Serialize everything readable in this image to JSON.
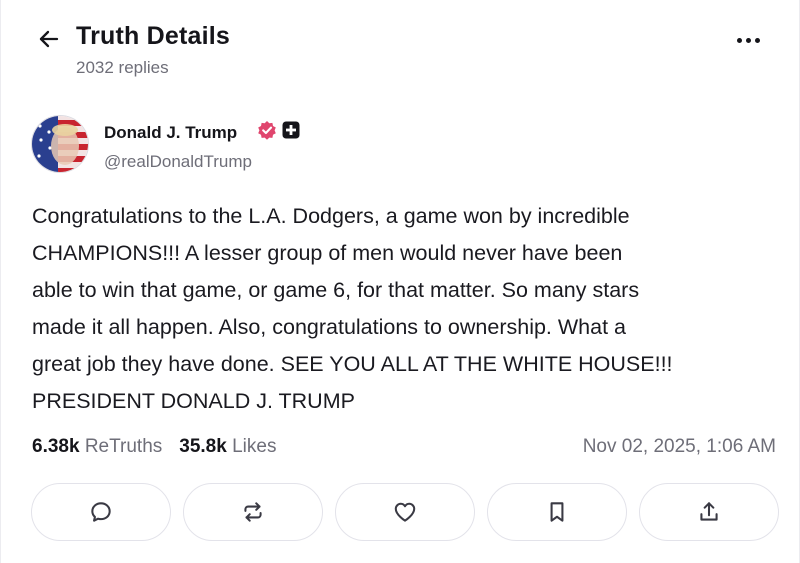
{
  "header": {
    "back_icon": "arrow-left-icon",
    "title": "Truth Details",
    "subtitle": "2032 replies",
    "more_icon": "more-horizontal-icon"
  },
  "author": {
    "name": "Donald J. Trump",
    "handle": "@realDonaldTrump",
    "verified_icon": "verified-badge-icon",
    "extra_icon": "plus-badge-icon",
    "verified_color": "#e0466e"
  },
  "post": {
    "lines": [
      "Congratulations to the L.A. Dodgers, a game won by incredible",
      "CHAMPIONS!!! A lesser group of men would never have been",
      "able to win that game, or game 6, for that matter. So many stars",
      "made it all happen. Also, congratulations to ownership. What a",
      "great job they have done. SEE YOU ALL AT THE WHITE HOUSE!!!",
      "PRESIDENT DONALD J. TRUMP"
    ]
  },
  "stats": {
    "retruths_count": "6.38k",
    "retruths_label": "ReTruths",
    "likes_count": "35.8k",
    "likes_label": "Likes",
    "timestamp": "Nov 02, 2025, 1:06 AM"
  },
  "actions": [
    {
      "icon": "reply-icon"
    },
    {
      "icon": "retruth-icon"
    },
    {
      "icon": "heart-icon"
    },
    {
      "icon": "bookmark-icon"
    },
    {
      "icon": "share-icon"
    }
  ]
}
